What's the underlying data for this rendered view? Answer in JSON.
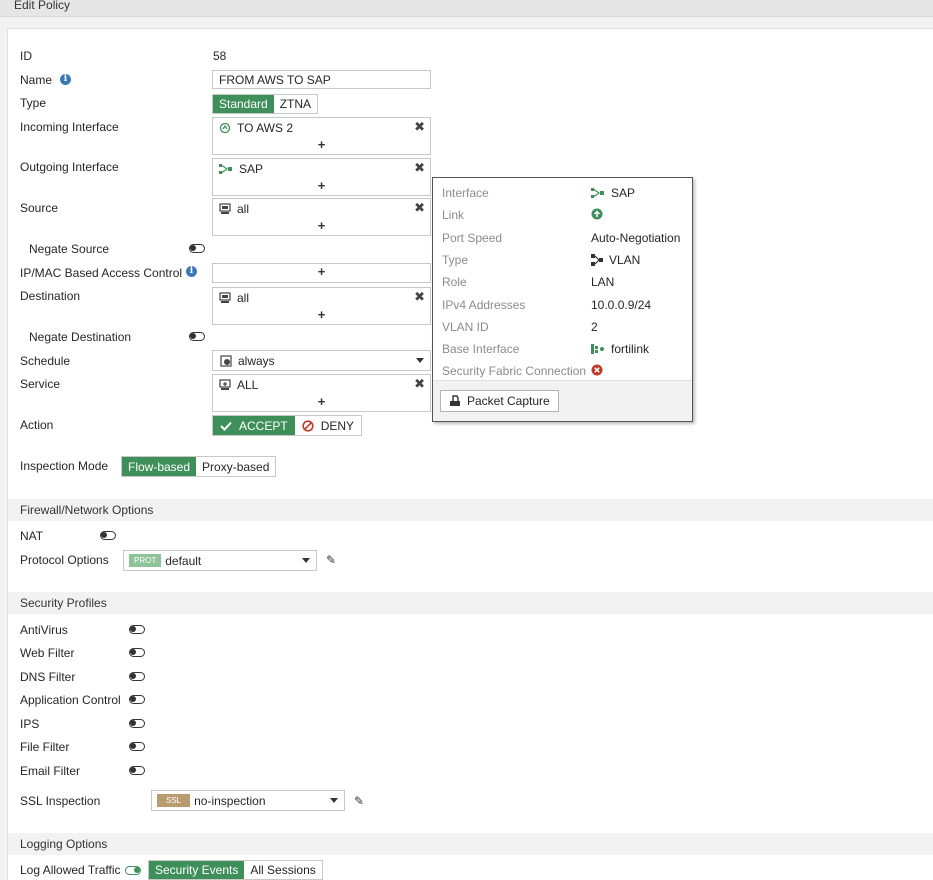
{
  "window": {
    "title": "Edit Policy"
  },
  "form": {
    "id": {
      "label": "ID",
      "value": "58"
    },
    "name": {
      "label": "Name",
      "value": "FROM AWS TO SAP"
    },
    "type": {
      "label": "Type",
      "options": [
        "Standard",
        "ZTNA"
      ],
      "selected": "Standard"
    },
    "incoming_interface": {
      "label": "Incoming Interface",
      "value": "TO AWS 2"
    },
    "outgoing_interface": {
      "label": "Outgoing Interface",
      "value": "SAP"
    },
    "source": {
      "label": "Source",
      "value": "all"
    },
    "negate_source": {
      "label": "Negate Source",
      "enabled": false
    },
    "ip_mac": {
      "label": "IP/MAC Based Access Control"
    },
    "destination": {
      "label": "Destination",
      "value": "all"
    },
    "negate_destination": {
      "label": "Negate Destination",
      "enabled": false
    },
    "schedule": {
      "label": "Schedule",
      "value": "always"
    },
    "service": {
      "label": "Service",
      "value": "ALL"
    },
    "action": {
      "label": "Action",
      "accept": "ACCEPT",
      "deny": "DENY",
      "selected": "ACCEPT"
    },
    "inspection_mode": {
      "label": "Inspection Mode",
      "options": [
        "Flow-based",
        "Proxy-based"
      ],
      "selected": "Flow-based"
    },
    "plus": "+",
    "remove": "✖"
  },
  "firewall": {
    "title": "Firewall/Network Options",
    "nat": {
      "label": "NAT",
      "enabled": false
    },
    "protocol_options": {
      "label": "Protocol Options",
      "badge": "PROT",
      "value": "default"
    }
  },
  "security_profiles": {
    "title": "Security Profiles",
    "items": [
      {
        "label": "AntiVirus",
        "enabled": false
      },
      {
        "label": "Web Filter",
        "enabled": false
      },
      {
        "label": "DNS Filter",
        "enabled": false
      },
      {
        "label": "Application Control",
        "enabled": false
      },
      {
        "label": "IPS",
        "enabled": false
      },
      {
        "label": "File Filter",
        "enabled": false
      },
      {
        "label": "Email Filter",
        "enabled": false
      }
    ],
    "ssl_inspection": {
      "label": "SSL Inspection",
      "badge": "SSL",
      "value": "no-inspection"
    }
  },
  "logging": {
    "title": "Logging Options",
    "log_allowed": {
      "label": "Log Allowed Traffic",
      "enabled": true,
      "options": [
        "Security Events",
        "All Sessions"
      ],
      "selected": "Security Events"
    }
  },
  "tooltip": {
    "rows": [
      {
        "key": "Interface",
        "value": "SAP",
        "icon": "vlan-icon"
      },
      {
        "key": "Link",
        "value": "",
        "icon": "link-up-icon"
      },
      {
        "key": "Port Speed",
        "value": "Auto-Negotiation"
      },
      {
        "key": "Type",
        "value": "VLAN",
        "icon": "vlan-type-icon"
      },
      {
        "key": "Role",
        "value": "LAN"
      },
      {
        "key": "IPv4 Addresses",
        "value": "10.0.0.9/24"
      },
      {
        "key": "VLAN ID",
        "value": "2"
      },
      {
        "key": "Base Interface",
        "value": "fortilink",
        "icon": "fortilink-icon"
      },
      {
        "key": "Security Fabric Connection",
        "value": "",
        "icon": "disabled-icon"
      }
    ],
    "button": "Packet Capture"
  },
  "colors": {
    "accent": "#3e8f5a",
    "deny": "#c0392b",
    "info": "#3a78b7",
    "prot_badge": "#8fc49a",
    "ssl_badge": "#b89b6e"
  }
}
